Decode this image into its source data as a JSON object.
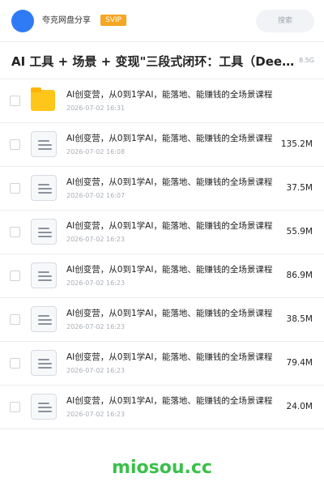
{
  "header": {
    "brand": "夸克网盘分享",
    "badge": "SVIP",
    "search_placeholder": "搜索"
  },
  "folder": {
    "title": "AI 工具 + 场景 + 变现\"三段式闭环：工具（DeepSeek",
    "meta": "8.5G"
  },
  "files": [
    {
      "type": "folder",
      "name": "AI创变营，从0到1学AI，能落地、能赚钱的全场景课程",
      "date": "2026-07-02 16:31",
      "size": ""
    },
    {
      "type": "doc",
      "name": "AI创变营，从0到1学AI，能落地、能赚钱的全场景课程",
      "date": "2026-07-02 16:08",
      "size": "135.2M"
    },
    {
      "type": "doc",
      "name": "AI创变营，从0到1学AI，能落地、能赚钱的全场景课程",
      "date": "2026-07-02 16:07",
      "size": "37.5M"
    },
    {
      "type": "doc",
      "name": "AI创变营，从0到1学AI，能落地、能赚钱的全场景课程",
      "date": "2026-07-02 16:23",
      "size": "55.9M"
    },
    {
      "type": "doc",
      "name": "AI创变营，从0到1学AI，能落地、能赚钱的全场景课程",
      "date": "2026-07-02 16:23",
      "size": "86.9M"
    },
    {
      "type": "doc",
      "name": "AI创变营，从0到1学AI，能落地、能赚钱的全场景课程",
      "date": "2026-07-02 16:23",
      "size": "38.5M"
    },
    {
      "type": "doc",
      "name": "AI创变营，从0到1学AI，能落地、能赚钱的全场景课程",
      "date": "2026-07-02 16:23",
      "size": "79.4M"
    },
    {
      "type": "doc",
      "name": "AI创变营，从0到1学AI，能落地、能赚钱的全场景课程",
      "date": "2026-07-02 16:23",
      "size": "24.0M"
    }
  ],
  "watermark": "miosou.cc",
  "colors": {
    "avatar": "#2f7bf6",
    "badge": "#f5a623",
    "folder": "#ffc61a",
    "watermark": "#3bbf4a"
  }
}
